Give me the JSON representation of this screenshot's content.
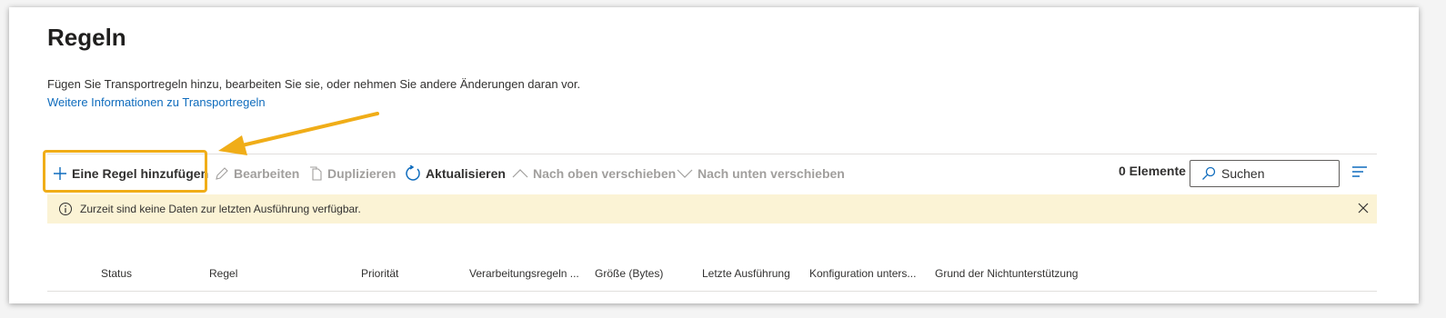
{
  "page": {
    "title": "Regeln",
    "description": "Fügen Sie Transportregeln hinzu, bearbeiten Sie sie, oder nehmen Sie andere Änderungen daran vor.",
    "link_text": "Weitere Informationen zu Transportregeln"
  },
  "toolbar": {
    "add_label": "Eine Regel hinzufügen",
    "edit_label": "Bearbeiten",
    "duplicate_label": "Duplizieren",
    "refresh_label": "Aktualisieren",
    "move_up_label": "Nach oben verschieben",
    "move_down_label": "Nach unten verschieben",
    "count": "0 Elemente",
    "search_placeholder": "Suchen"
  },
  "banner": {
    "text": "Zurzeit sind keine Daten zur letzten Ausführung verfügbar."
  },
  "table": {
    "columns": [
      "Status",
      "Regel",
      "Priorität",
      "Verarbeitungsregeln ...",
      "Größe (Bytes)",
      "Letzte Ausführung",
      "Konfiguration unters...",
      "Grund der Nichtunterstützung"
    ]
  },
  "colors": {
    "accent": "#0f6cbd",
    "highlight": "#f0ad18",
    "banner": "#fbf3d5"
  }
}
